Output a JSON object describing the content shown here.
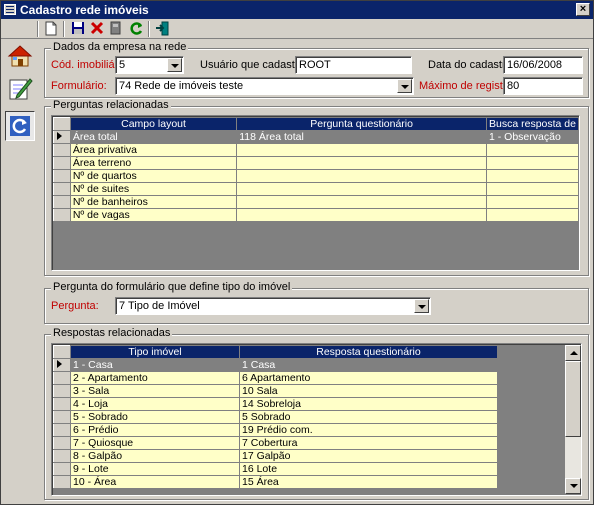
{
  "window": {
    "title": "Cadastro rede imóveis",
    "close_glyph": "×"
  },
  "toolbar": {
    "buttons": [
      {
        "name": "new-icon",
        "glyph": "🗋",
        "color": "#ffffff"
      },
      {
        "name": "save-icon",
        "glyph": "💾",
        "color": "#000080"
      },
      {
        "name": "delete-icon",
        "glyph": "✖",
        "color": "#cc0000"
      },
      {
        "name": "print-icon",
        "glyph": "▣",
        "color": "#606060"
      },
      {
        "name": "refresh-icon",
        "glyph": "⟳",
        "color": "#008000"
      },
      {
        "name": "exit-icon",
        "glyph": "⇥",
        "color": "#006060"
      }
    ]
  },
  "sidebar": {
    "items": [
      {
        "name": "house-icon",
        "glyph": "🏠"
      },
      {
        "name": "edit-document-icon",
        "glyph": "📝"
      },
      {
        "name": "network-refresh-icon",
        "glyph": "🔄"
      }
    ]
  },
  "dados": {
    "title": "Dados da empresa na rede",
    "cod_label": "Cód. imobiliária:",
    "cod_value": "5",
    "usuario_label": "Usuário que cadastrou:",
    "usuario_value": "ROOT",
    "data_label": "Data do cadastro:",
    "data_value": "16/06/2008",
    "formulario_label": "Formulário:",
    "formulario_value": "74  Rede de imóveis teste",
    "maximo_label": "Máximo de registros:",
    "maximo_value": "80"
  },
  "perguntas": {
    "title": "Perguntas relacionadas",
    "columns": [
      "Campo layout",
      "Pergunta questionário",
      "Busca resposta de"
    ],
    "rows": [
      [
        "Área total",
        "118  Área total",
        "1 - Observação"
      ],
      [
        "Área privativa",
        "",
        ""
      ],
      [
        "Área terreno",
        "",
        ""
      ],
      [
        "Nº de quartos",
        "",
        ""
      ],
      [
        "Nº de suites",
        "",
        ""
      ],
      [
        "Nº de banheiros",
        "",
        ""
      ],
      [
        "Nº de vagas",
        "",
        ""
      ]
    ]
  },
  "tipo": {
    "title": "Pergunta do formulário que define tipo do imóvel",
    "pergunta_label": "Pergunta:",
    "pergunta_value": "7  Tipo de Imóvel"
  },
  "respostas": {
    "title": "Respostas relacionadas",
    "columns": [
      "Tipo imóvel",
      "Resposta questionário"
    ],
    "rows": [
      [
        "1 - Casa",
        "1  Casa"
      ],
      [
        "2 - Apartamento",
        "6  Apartamento"
      ],
      [
        "3 - Sala",
        "10  Sala"
      ],
      [
        "4 - Loja",
        "14  Sobreloja"
      ],
      [
        "5 - Sobrado",
        "5  Sobrado"
      ],
      [
        "6 - Prédio",
        "19  Prédio com."
      ],
      [
        "7 - Quiosque",
        "7  Cobertura"
      ],
      [
        "8 - Galpão",
        "17  Galpão"
      ],
      [
        "9 - Lote",
        "16  Lote"
      ],
      [
        "10 - Área",
        "15  Área"
      ]
    ]
  }
}
